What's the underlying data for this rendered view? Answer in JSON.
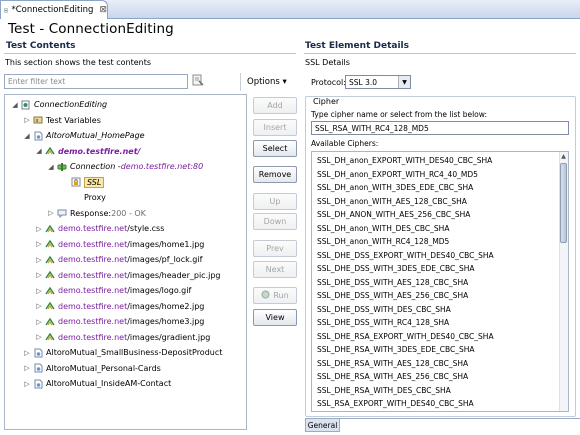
{
  "editor_tab": {
    "title": "*ConnectionEditing",
    "close": "⊠"
  },
  "editor_title": "Test - ConnectionEditing",
  "left": {
    "section_title": "Test Contents",
    "description": "This section shows the test contents",
    "filter_placeholder": "Enter filter text",
    "options_label": "Options ▾",
    "tree": [
      {
        "twisty": "◢",
        "icon": "test",
        "parts": [
          {
            "t": "ConnectionEditing",
            "c": "it"
          }
        ]
      },
      {
        "twisty": "▷",
        "icon": "vars",
        "parts": [
          {
            "t": "Test Variables",
            "c": ""
          }
        ]
      },
      {
        "twisty": "◢",
        "icon": "page",
        "parts": [
          {
            "t": "AltoroMutual_HomePage",
            "c": "it"
          }
        ]
      },
      {
        "twisty": "◢",
        "icon": "request",
        "parts": [
          {
            "t": "demo.testfire.net/",
            "c": "host bold it"
          }
        ]
      },
      {
        "twisty": "◢",
        "icon": "connection",
        "parts": [
          {
            "t": "Connection - ",
            "c": "it"
          },
          {
            "t": "demo.testfire.net:80",
            "c": "host it"
          }
        ]
      },
      {
        "twisty": "",
        "icon": "ssl",
        "parts": [
          {
            "t": "SSL",
            "c": "it sel"
          }
        ]
      },
      {
        "twisty": "",
        "icon": "proxy",
        "parts": [
          {
            "t": "Proxy",
            "c": ""
          }
        ]
      },
      {
        "twisty": "▷",
        "icon": "response",
        "parts": [
          {
            "t": "Response: ",
            "c": ""
          },
          {
            "t": "200 - OK",
            "c": "gray"
          }
        ]
      },
      {
        "twisty": "▷",
        "icon": "request",
        "parts": [
          {
            "t": "demo.testfire.net",
            "c": "host"
          },
          {
            "t": "/style.css",
            "c": ""
          }
        ]
      },
      {
        "twisty": "▷",
        "icon": "request",
        "parts": [
          {
            "t": "demo.testfire.net",
            "c": "host"
          },
          {
            "t": "/images/home1.jpg",
            "c": ""
          }
        ]
      },
      {
        "twisty": "▷",
        "icon": "request",
        "parts": [
          {
            "t": "demo.testfire.net",
            "c": "host"
          },
          {
            "t": "/images/pf_lock.gif",
            "c": ""
          }
        ]
      },
      {
        "twisty": "▷",
        "icon": "request",
        "parts": [
          {
            "t": "demo.testfire.net",
            "c": "host"
          },
          {
            "t": "/images/header_pic.jpg",
            "c": ""
          }
        ]
      },
      {
        "twisty": "▷",
        "icon": "request",
        "parts": [
          {
            "t": "demo.testfire.net",
            "c": "host"
          },
          {
            "t": "/images/logo.gif",
            "c": ""
          }
        ]
      },
      {
        "twisty": "▷",
        "icon": "request",
        "parts": [
          {
            "t": "demo.testfire.net",
            "c": "host"
          },
          {
            "t": "/images/home2.jpg",
            "c": ""
          }
        ]
      },
      {
        "twisty": "▷",
        "icon": "request",
        "parts": [
          {
            "t": "demo.testfire.net",
            "c": "host"
          },
          {
            "t": "/images/home3.jpg",
            "c": ""
          }
        ]
      },
      {
        "twisty": "▷",
        "icon": "request",
        "parts": [
          {
            "t": "demo.testfire.net",
            "c": "host"
          },
          {
            "t": "/images/gradient.jpg",
            "c": ""
          }
        ]
      },
      {
        "twisty": "▷",
        "icon": "page",
        "parts": [
          {
            "t": "AltoroMutual_SmallBusiness-DepositProduct",
            "c": ""
          }
        ]
      },
      {
        "twisty": "▷",
        "icon": "page",
        "parts": [
          {
            "t": "AltoroMutual_Personal-Cards",
            "c": ""
          }
        ]
      },
      {
        "twisty": "▷",
        "icon": "page",
        "parts": [
          {
            "t": "AltoroMutual_InsideAM-Contact",
            "c": ""
          }
        ]
      }
    ]
  },
  "buttons": [
    {
      "label": "Add",
      "enabled": false
    },
    {
      "label": "Insert",
      "enabled": false
    },
    {
      "label": "Select",
      "enabled": true
    },
    {
      "label": "Remove",
      "enabled": true
    },
    {
      "label": "Up",
      "enabled": false
    },
    {
      "label": "Down",
      "enabled": false
    },
    {
      "label": "Prev",
      "enabled": false
    },
    {
      "label": "Next",
      "enabled": false
    },
    {
      "label": "Run",
      "enabled": false
    },
    {
      "label": "View",
      "enabled": true
    }
  ],
  "right": {
    "section_title": "Test Element Details",
    "subtitle": "SSL Details",
    "protocol_label": "Protocol:",
    "protocol_value": "SSL 3.0",
    "cipher_group": "Cipher",
    "cipher_prompt": "Type cipher name or select from the list below:",
    "cipher_value": "SSL_RSA_WITH_RC4_128_MD5",
    "available_label": "Available Ciphers:",
    "ciphers": [
      "SSL_DH_anon_EXPORT_WITH_DES40_CBC_SHA",
      "SSL_DH_anon_EXPORT_WITH_RC4_40_MD5",
      "SSL_DH_anon_WITH_3DES_EDE_CBC_SHA",
      "SSL_DH_anon_WITH_AES_128_CBC_SHA",
      "SSL_DH_ANON_WITH_AES_256_CBC_SHA",
      "SSL_DH_anon_WITH_DES_CBC_SHA",
      "SSL_DH_anon_WITH_RC4_128_MD5",
      "SSL_DHE_DSS_EXPORT_WITH_DES40_CBC_SHA",
      "SSL_DHE_DSS_WITH_3DES_EDE_CBC_SHA",
      "SSL_DHE_DSS_WITH_AES_128_CBC_SHA",
      "SSL_DHE_DSS_WITH_AES_256_CBC_SHA",
      "SSL_DHE_DSS_WITH_DES_CBC_SHA",
      "SSL_DHE_DSS_WITH_RC4_128_SHA",
      "SSL_DHE_RSA_EXPORT_WITH_DES40_CBC_SHA",
      "SSL_DHE_RSA_WITH_3DES_EDE_CBC_SHA",
      "SSL_DHE_RSA_WITH_AES_128_CBC_SHA",
      "SSL_DHE_RSA_WITH_AES_256_CBC_SHA",
      "SSL_DHE_RSA_WITH_DES_CBC_SHA",
      "SSL_RSA_EXPORT_WITH_DES40_CBC_SHA"
    ],
    "bottom_tab": "General"
  }
}
